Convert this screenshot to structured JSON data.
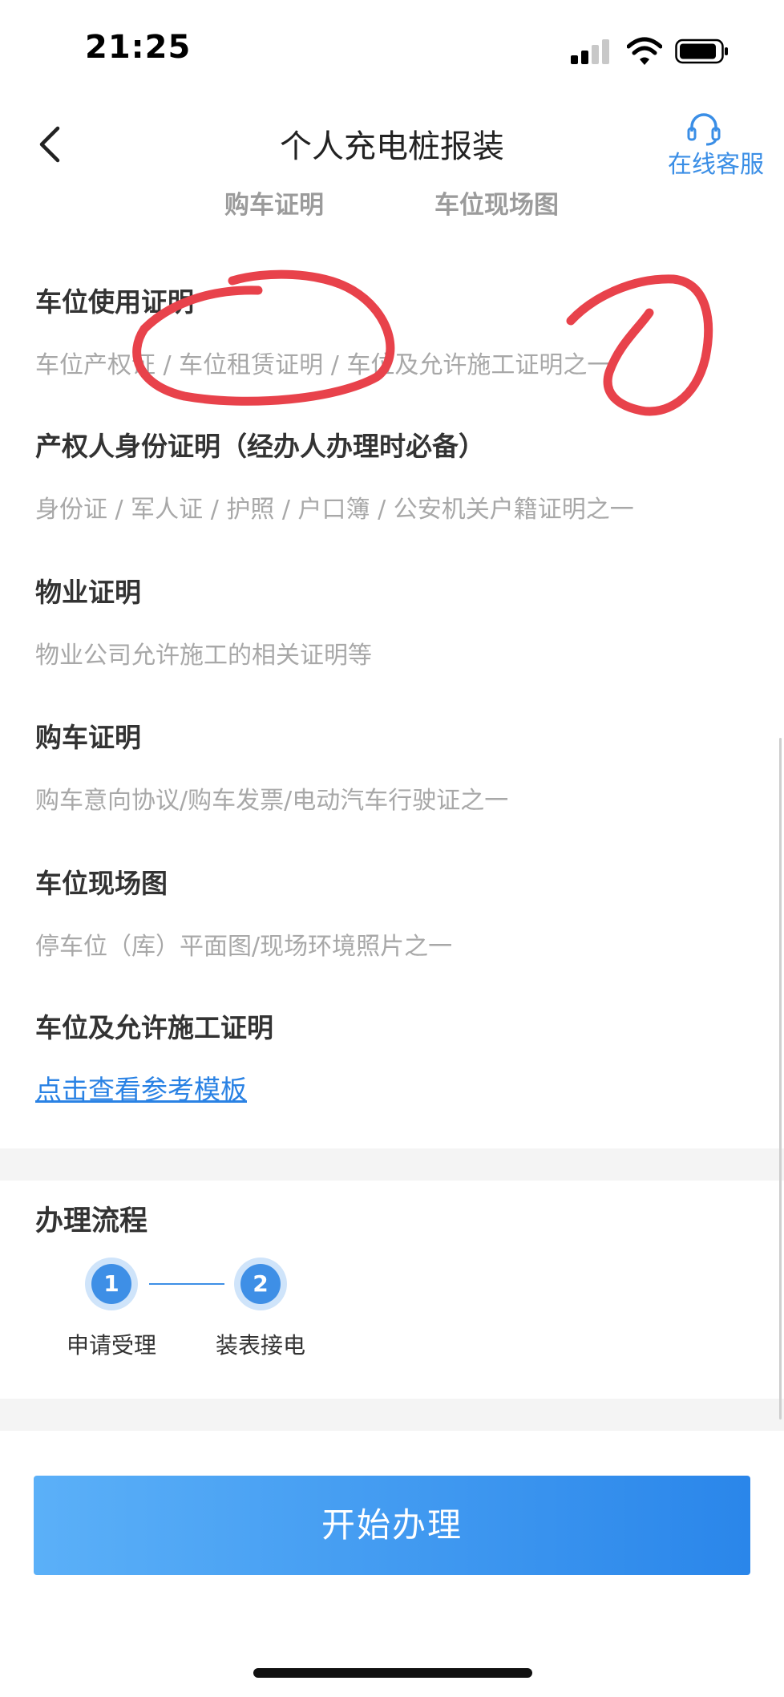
{
  "status_bar": {
    "time": "21:25"
  },
  "nav": {
    "title": "个人充电桩报装",
    "service_label": "在线客服"
  },
  "tabs": [
    "购车证明",
    "车位现场图"
  ],
  "sections": [
    {
      "title": "车位使用证明",
      "desc": "车位产权证 / 车位租赁证明 / 车位及允许施工证明之一"
    },
    {
      "title": "产权人身份证明（经办人办理时必备）",
      "desc": "身份证 / 军人证 / 护照 / 户口簿 / 公安机关户籍证明之一"
    },
    {
      "title": "物业证明",
      "desc": "物业公司允许施工的相关证明等"
    },
    {
      "title": "购车证明",
      "desc": "购车意向协议/购车发票/电动汽车行驶证之一"
    },
    {
      "title": "车位现场图",
      "desc": "停车位（库）平面图/现场环境照片之一"
    },
    {
      "title": "车位及允许施工证明",
      "link": "点击查看参考模板"
    }
  ],
  "process": {
    "title": "办理流程",
    "steps": [
      {
        "number": "1",
        "label": "申请受理"
      },
      {
        "number": "2",
        "label": "装表接电"
      }
    ]
  },
  "start_button": "开始办理",
  "colors": {
    "accent": "#3e8fe6",
    "link": "#2a82e4",
    "annotation": "#e8424b"
  }
}
